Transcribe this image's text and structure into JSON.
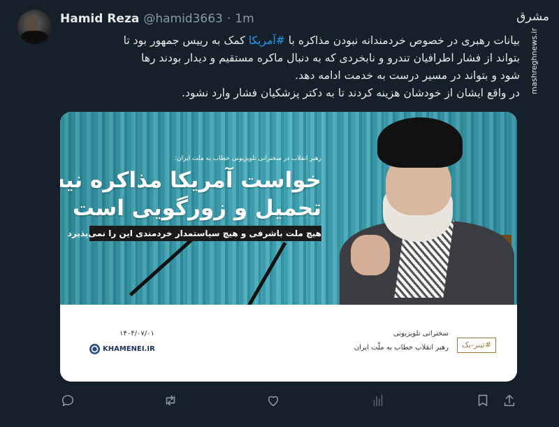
{
  "author": {
    "name": "Hamid Reza",
    "handle": "@hamid3663",
    "separator": "·",
    "time": "1m"
  },
  "watermark": {
    "logo_text": "مشرق",
    "url": "mashreghnews.ir"
  },
  "tweet_lines": [
    "بیانات رهبری در خصوص خردمندانه نبودن مذاکره با #آمریکا کمک به رییس جمهور بود تا",
    "بتواند از فشار اطرافیان تندرو و نابخردی که به دنبال ماکره مستقیم و دیدار بودند رها",
    "شود و بتواند در مسیر درست به خدمت ادامه دهد.",
    "در واقع ایشان از خودشان هزینه کردند تا به دکتر پزشکیان فشار وارد نشود."
  ],
  "tweet_segments": {
    "line1_before": "بیانات رهبری در خصوص خردمندانه نبودن مذاکره با ",
    "line1_hashtag": "#آمریکا",
    "line1_after": " کمک به رییس جمهور بود تا"
  },
  "card": {
    "caption_small": "رهبر انقلاب در سخنرانی تلویزیونی خطاب به ملت ایران:",
    "headline_line1": "خواست آمریکا مذاکره نیست",
    "headline_line2": "تحمیل و زورگویی است",
    "subheadline": "هیچ ملت باشرفی و هیچ سیاستمدار خردمندی این را نمی‌پذیرد",
    "footer_tag": "#تیتر-یک",
    "footer_line1": "سخنرانی تلویزیونی",
    "footer_line2": "رهبر انقلاب خطاب به ملّت ایران",
    "footer_date": "۱۴۰۴/۰۷/۰۱",
    "footer_logo": "KHAMENEI.IR"
  },
  "actions": [
    {
      "name": "reply-icon"
    },
    {
      "name": "retweet-icon"
    },
    {
      "name": "like-icon"
    },
    {
      "name": "views-icon"
    },
    {
      "name": "bookmark-icon"
    },
    {
      "name": "share-icon"
    }
  ],
  "colors": {
    "background": "#15202b",
    "text": "#e7e9ea",
    "muted": "#8b98a5",
    "link": "#1d9bf0"
  }
}
